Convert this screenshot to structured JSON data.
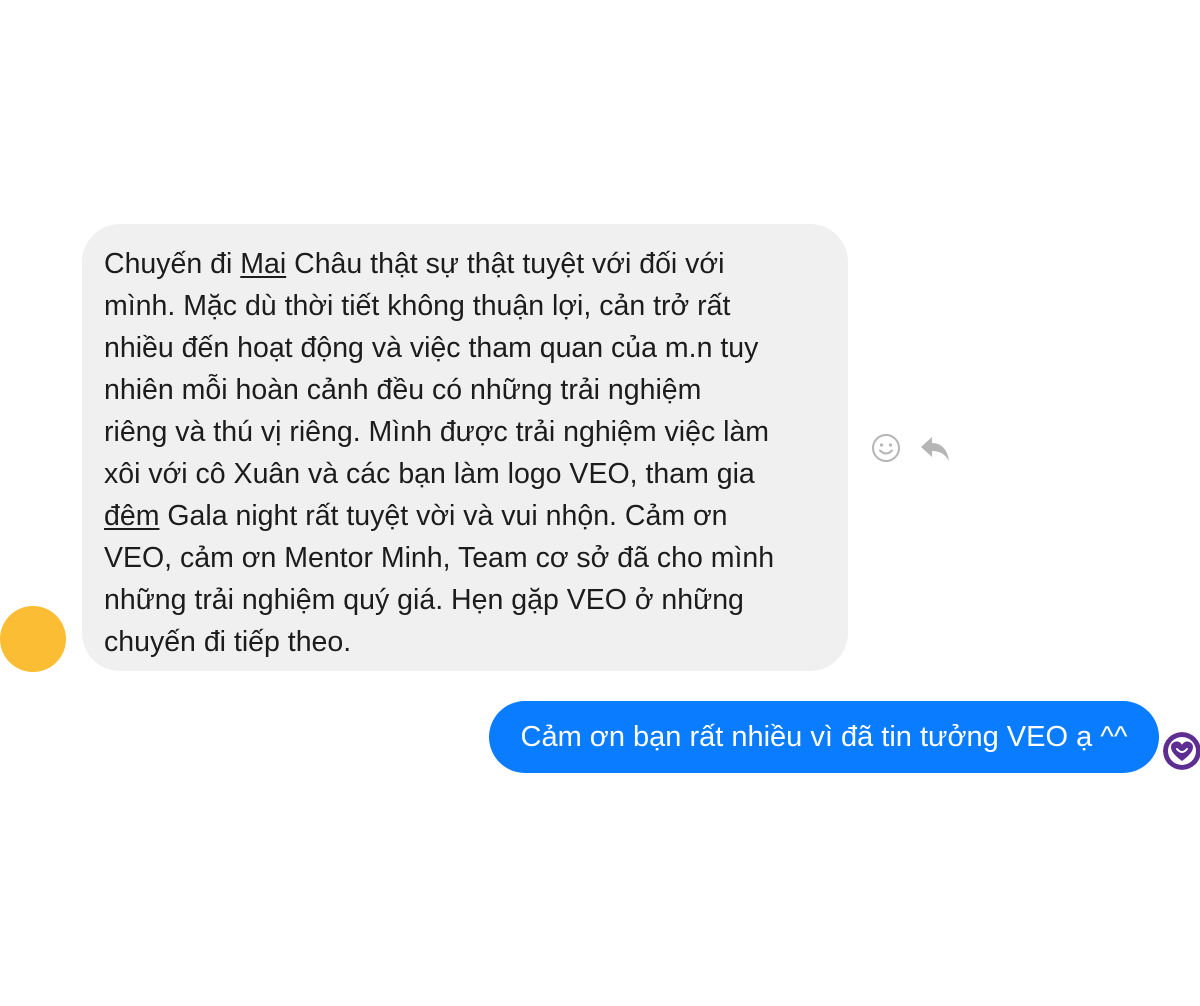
{
  "incoming_message": {
    "lines": [
      {
        "pre": "Chuyến đi ",
        "underlined": "Mai",
        "post": " Châu thật sự thật tuyệt với đối với"
      },
      {
        "text": "mình. Mặc dù thời tiết không thuận lợi, cản trở rất"
      },
      {
        "text": "nhiều đến hoạt động và việc tham quan của m.n tuy"
      },
      {
        "text": "nhiên mỗi hoàn cảnh đều có những trải nghiệm"
      },
      {
        "text": "riêng và thú vị riêng. Mình được trải nghiệm việc làm"
      },
      {
        "text": "xôi với cô Xuân và các bạn làm logo VEO, tham gia"
      },
      {
        "underlined": "đêm",
        "post": " Gala night rất tuyệt vời và vui nhộn. Cảm ơn"
      },
      {
        "text": "VEO, cảm ơn Mentor Minh, Team cơ sở đã cho mình"
      },
      {
        "text": "những trải nghiệm quý giá. Hẹn gặp VEO ở những"
      },
      {
        "text": "chuyến đi tiếp theo."
      }
    ]
  },
  "message_actions": [
    {
      "icon": "smiley-reaction-icon"
    },
    {
      "icon": "reply-arrow-icon"
    }
  ],
  "outgoing_message": {
    "text": "Cảm ơn bạn rất nhiều vì đã tin tưởng VEO ạ ^^"
  },
  "colors": {
    "incoming_bubble": "#f0f0f0",
    "outgoing_bubble": "#0a7cff",
    "sender_avatar": "#fbbd33",
    "self_avatar": "#5e2d91"
  }
}
